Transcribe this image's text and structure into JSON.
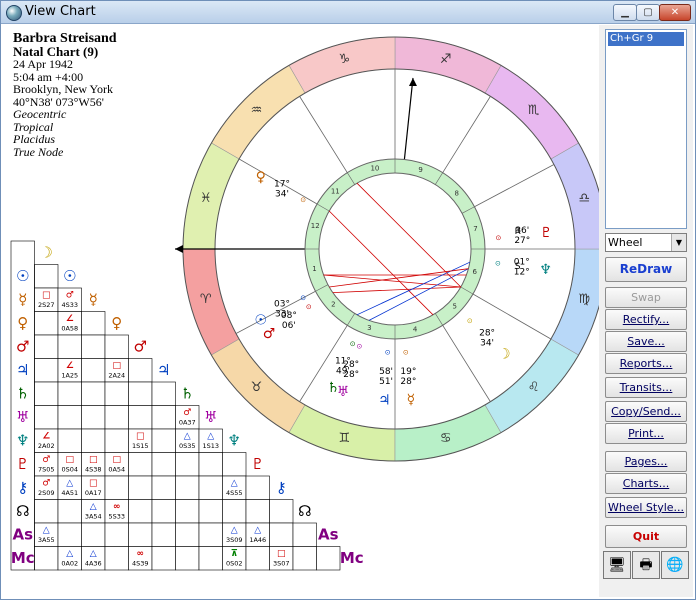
{
  "window": {
    "title": "View Chart"
  },
  "chart_info": {
    "name": "Barbra Streisand",
    "chart_title": "Natal Chart (9)",
    "date": "24 Apr 1942",
    "time": "5:04 am  +4:00",
    "place": "Brooklyn, New York",
    "coords": "40°N38' 073°W56'",
    "options": [
      "Geocentric",
      "Tropical",
      "Placidus",
      "True Node"
    ]
  },
  "sidebar": {
    "list_items": [
      "Ch+Gr 9"
    ],
    "wheel_select": "Wheel",
    "buttons": [
      "ReDraw",
      "Swap",
      "Rectify...",
      "Save...",
      "Reports...",
      "Transits...",
      "Copy/Send...",
      "Print...",
      "Pages...",
      "Charts...",
      "Wheel Style...",
      "Quit"
    ]
  },
  "wheel": {
    "signs": [
      "♈",
      "♉",
      "♊",
      "♋",
      "♌",
      "♍",
      "♎",
      "♏",
      "♐",
      "♑",
      "♒",
      "♓"
    ],
    "sign_colors": [
      "#f4a0a0",
      "#f6d8a8",
      "#d8f0a8",
      "#b8f0c8",
      "#b8e8f0",
      "#b8d8f8",
      "#c8c8f8",
      "#e8b8f0",
      "#f0b8d8",
      "#f8c8c8",
      "#f8e0b0",
      "#e0f0b0"
    ],
    "house_numbers": [
      "1",
      "2",
      "3",
      "4",
      "5",
      "6",
      "7",
      "8",
      "9",
      "10",
      "11",
      "12"
    ],
    "positions": [
      {
        "glyph": "♀",
        "deg": "17°",
        "min": "34'",
        "color": "#c06000"
      },
      {
        "glyph": "☉",
        "deg": "03°",
        "min": "33'",
        "color": "#0040c0"
      },
      {
        "glyph": "♂",
        "deg": "08°",
        "min": "06'",
        "color": "#c00000"
      },
      {
        "glyph": "♄",
        "deg": "11°",
        "min": "49'",
        "color": "#006000"
      },
      {
        "glyph": "♅",
        "deg": "28°",
        "min": "28°",
        "color": "#a000a0"
      },
      {
        "glyph": "♃",
        "deg": "58'",
        "min": "51'",
        "color": "#0040c0"
      },
      {
        "glyph": "☿",
        "deg": "19°",
        "min": "28°",
        "color": "#c06000"
      },
      {
        "glyph": "☽",
        "deg": "28°",
        "min": "34'",
        "color": "#c0a000"
      },
      {
        "glyph": "♇",
        "deg": "36'",
        "min": "27°",
        "color": "#c00000"
      },
      {
        "glyph": "♆",
        "deg": "01°",
        "min": "12°",
        "color": "#008080"
      }
    ],
    "labels": [
      "R",
      "S",
      "ASC",
      "MC"
    ]
  },
  "aspect_grid": {
    "planets": [
      "☽",
      "☉",
      "☿",
      "♀",
      "♂",
      "♃",
      "♄",
      "♅",
      "♆",
      "♇",
      "⚷",
      "☊",
      "As",
      "Mc"
    ],
    "planet_colors": [
      "#c0a000",
      "#0040c0",
      "#c06000",
      "#c06000",
      "#c00000",
      "#0040c0",
      "#006000",
      "#a000a0",
      "#008080",
      "#c00000",
      "#0040c0",
      "#000000",
      "#800080",
      "#800080"
    ],
    "cells": [
      {
        "r": 2,
        "c": 1,
        "g": "□",
        "t": "2S27"
      },
      {
        "r": 2,
        "c": 2,
        "g": "♂",
        "t": "4S33"
      },
      {
        "r": 3,
        "c": 2,
        "g": "∠",
        "t": "0A58"
      },
      {
        "r": 5,
        "c": 2,
        "g": "∠",
        "t": "1A25"
      },
      {
        "r": 5,
        "c": 4,
        "g": "□",
        "t": "2A24"
      },
      {
        "r": 7,
        "c": 7,
        "g": "♂",
        "t": "0A37"
      },
      {
        "r": 8,
        "c": 1,
        "g": "∠",
        "t": "2A02"
      },
      {
        "r": 8,
        "c": 5,
        "g": "□",
        "t": "1S15"
      },
      {
        "r": 8,
        "c": 7,
        "g": "△",
        "t": "0S35"
      },
      {
        "r": 8,
        "c": 8,
        "g": "△",
        "t": "1S13"
      },
      {
        "r": 9,
        "c": 1,
        "g": "♂",
        "t": "7S05"
      },
      {
        "r": 9,
        "c": 2,
        "g": "□",
        "t": "0S04"
      },
      {
        "r": 9,
        "c": 3,
        "g": "□",
        "t": "4S38"
      },
      {
        "r": 9,
        "c": 4,
        "g": "□",
        "t": "0A54"
      },
      {
        "r": 10,
        "c": 1,
        "g": "♂",
        "t": "2S09"
      },
      {
        "r": 10,
        "c": 2,
        "g": "△",
        "t": "4A51"
      },
      {
        "r": 10,
        "c": 3,
        "g": "□",
        "t": "0A17"
      },
      {
        "r": 10,
        "c": 9,
        "g": "△",
        "t": "4S55"
      },
      {
        "r": 11,
        "c": 3,
        "g": "△",
        "t": "3A54"
      },
      {
        "r": 11,
        "c": 4,
        "g": "∞",
        "t": "5S33"
      },
      {
        "r": 12,
        "c": 1,
        "g": "△",
        "t": "3A55"
      },
      {
        "r": 12,
        "c": 9,
        "g": "△",
        "t": "3S09"
      },
      {
        "r": 12,
        "c": 10,
        "g": "△",
        "t": "1A46"
      },
      {
        "r": 13,
        "c": 2,
        "g": "△",
        "t": "0A02"
      },
      {
        "r": 13,
        "c": 3,
        "g": "△",
        "t": "4A36"
      },
      {
        "r": 13,
        "c": 5,
        "g": "∞",
        "t": "4S39"
      },
      {
        "r": 13,
        "c": 9,
        "g": "⊼",
        "t": "0S02"
      },
      {
        "r": 13,
        "c": 11,
        "g": "□",
        "t": "3S07"
      }
    ]
  }
}
